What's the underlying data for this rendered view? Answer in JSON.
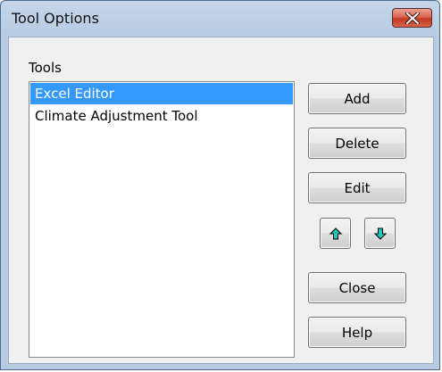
{
  "window": {
    "title": "Tool Options"
  },
  "tools": {
    "label": "Tools",
    "items": [
      {
        "label": "Excel Editor",
        "selected": true
      },
      {
        "label": "Climate Adjustment Tool",
        "selected": false
      }
    ]
  },
  "buttons": {
    "add": "Add",
    "delete": "Delete",
    "edit": "Edit",
    "close": "Close",
    "help": "Help"
  },
  "icons": {
    "move_up": "arrow-up-icon",
    "move_down": "arrow-down-icon",
    "close": "close-icon"
  },
  "colors": {
    "selection": "#3399ff",
    "arrow_fill": "#22c3b8",
    "close_button": "#c2371f"
  }
}
